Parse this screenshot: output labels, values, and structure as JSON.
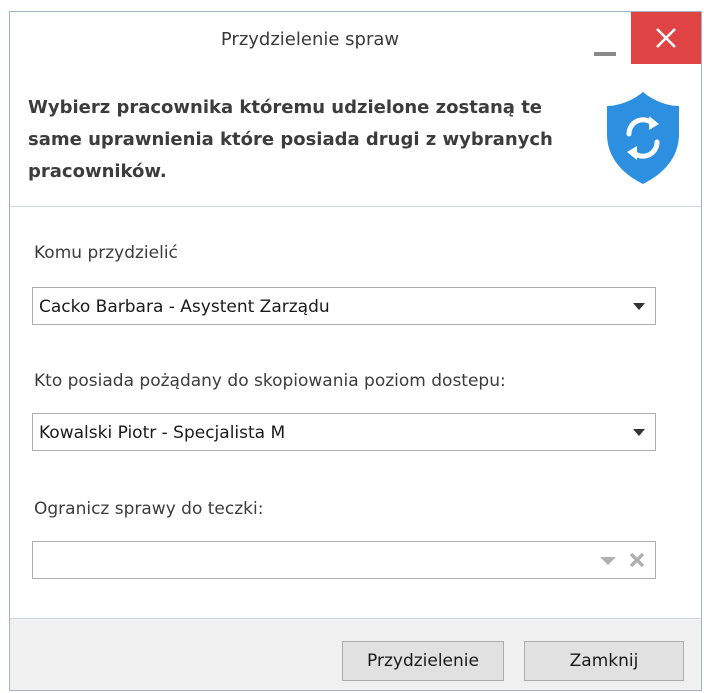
{
  "window": {
    "title": "Przydzielenie spraw"
  },
  "header": {
    "description": "Wybierz pracownika któremu udzielone zostaną te same uprawnienia które posiada drugi z wybranych pracowników."
  },
  "form": {
    "assign_to_label": "Komu przydzielić",
    "assign_to_value": "Cacko Barbara - Asystent Zarządu",
    "source_label": "Kto posiada pożądany do skopiowania poziom dostepu:",
    "source_value": "Kowalski Piotr - Specjalista M",
    "folder_label": "Ogranicz sprawy do teczki:",
    "folder_value": ""
  },
  "footer": {
    "assign_button": "Przydzielenie",
    "close_button": "Zamknij"
  },
  "colors": {
    "close_button_bg": "#e04343",
    "shield": "#2d8fe0",
    "footer_bg": "#f0f0f0"
  },
  "icons": {
    "header_icon": "shield-sync-icon",
    "window_close": "close-icon",
    "window_minimize": "minimize-icon"
  }
}
